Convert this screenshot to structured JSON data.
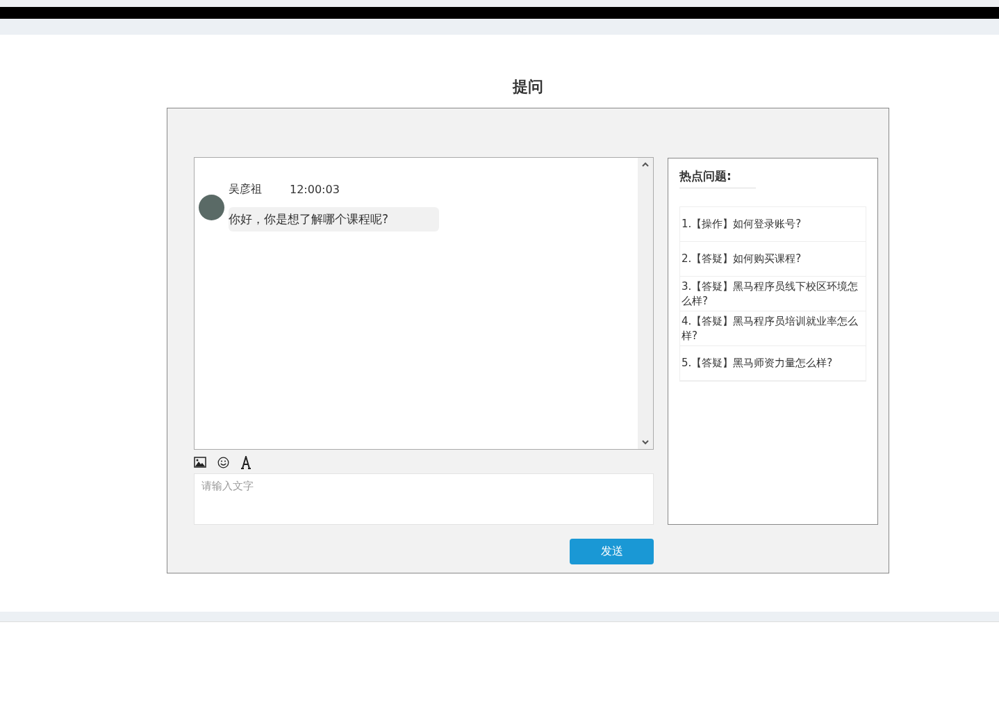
{
  "title": "提问",
  "messages": [
    {
      "name": "吴彦祖",
      "time": "12:00:03",
      "text": "你好，你是想了解哪个课程呢?"
    }
  ],
  "composer": {
    "placeholder": "请输入文字",
    "send": "发送"
  },
  "hot": {
    "title": "热点问题:",
    "items": [
      "1.【操作】如何登录账号?",
      "2.【答疑】如何购买课程?",
      "3.【答疑】黑马程序员线下校区环境怎么样?",
      "4.【答疑】黑马程序员培训就业率怎么样?",
      "5.【答疑】黑马师资力量怎么样?"
    ]
  }
}
